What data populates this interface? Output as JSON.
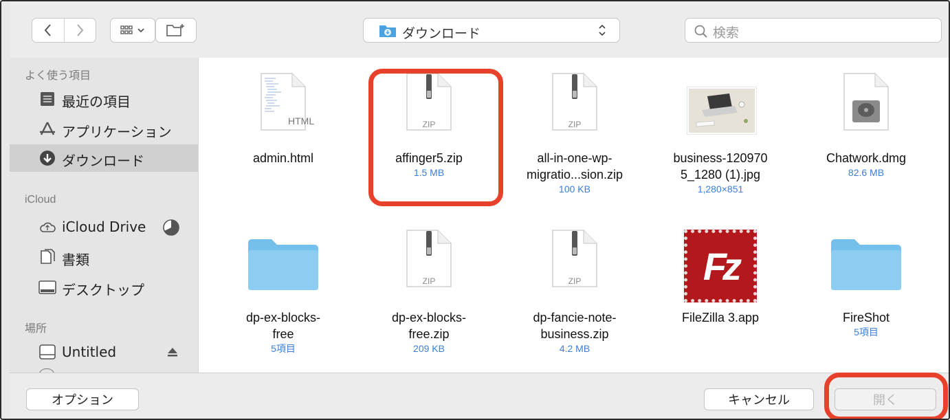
{
  "toolbar": {
    "location": "ダウンロード",
    "search_placeholder": "検索"
  },
  "sidebar": {
    "favorites_header": "よく使う項目",
    "favorites": [
      {
        "label": "最近の項目",
        "icon": "recents-icon"
      },
      {
        "label": "アプリケーション",
        "icon": "applications-icon"
      },
      {
        "label": "ダウンロード",
        "icon": "downloads-icon",
        "selected": true
      }
    ],
    "icloud_header": "iCloud",
    "icloud": [
      {
        "label": "iCloud Drive",
        "icon": "cloud-icon"
      },
      {
        "label": "書類",
        "icon": "documents-icon"
      },
      {
        "label": "デスクトップ",
        "icon": "desktop-icon"
      }
    ],
    "locations_header": "場所",
    "locations": [
      {
        "label": "Untitled",
        "icon": "disk-icon"
      }
    ]
  },
  "files": [
    {
      "name_line1": "admin.html",
      "name_line2": "",
      "meta": "",
      "kind": "html",
      "badge": "HTML"
    },
    {
      "name_line1": "affinger5.zip",
      "name_line2": "",
      "meta": "1.5 MB",
      "kind": "zip",
      "badge": "ZIP"
    },
    {
      "name_line1": "all-in-one-wp-",
      "name_line2": "migratio...sion.zip",
      "meta": "100 KB",
      "kind": "zip",
      "badge": "ZIP"
    },
    {
      "name_line1": "business-120970",
      "name_line2": "5_1280 (1).jpg",
      "meta": "1,280×851",
      "kind": "image",
      "badge": ""
    },
    {
      "name_line1": "Chatwork.dmg",
      "name_line2": "",
      "meta": "82.6 MB",
      "kind": "dmg",
      "badge": ""
    },
    {
      "name_line1": "dp-ex-blocks-",
      "name_line2": "free",
      "meta": "5項目",
      "kind": "folder",
      "badge": ""
    },
    {
      "name_line1": "dp-ex-blocks-",
      "name_line2": "free.zip",
      "meta": "209 KB",
      "kind": "zip",
      "badge": "ZIP"
    },
    {
      "name_line1": "dp-fancie-note-",
      "name_line2": "business.zip",
      "meta": "4.2 MB",
      "kind": "zip",
      "badge": "ZIP"
    },
    {
      "name_line1": "FileZilla 3.app",
      "name_line2": "",
      "meta": "",
      "kind": "app",
      "badge": ""
    },
    {
      "name_line1": "FireShot",
      "name_line2": "",
      "meta": "5項目",
      "kind": "folder",
      "badge": ""
    }
  ],
  "filezilla_letters": "Fz",
  "footer": {
    "options_label": "オプション",
    "cancel_label": "キャンセル",
    "open_label": "開く"
  },
  "colors": {
    "highlight": "#e8412b",
    "accent_text": "#3a7ed6",
    "folder": "#7cc3ee",
    "filezilla": "#b3191c"
  }
}
